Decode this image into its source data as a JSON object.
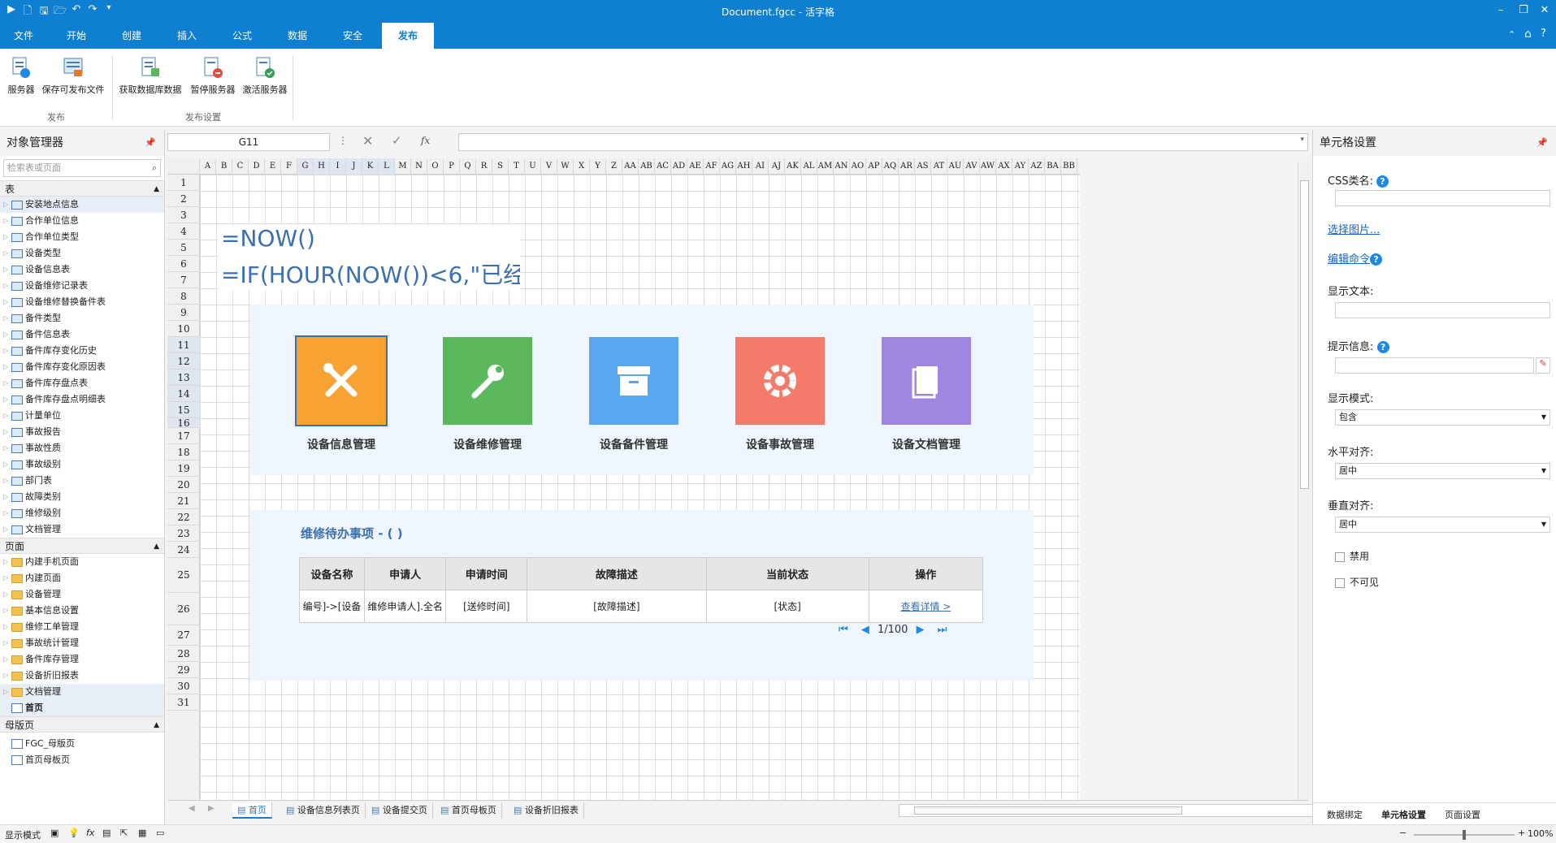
{
  "window": {
    "title": "Document.fgcc - 活字格"
  },
  "menu": {
    "tabs": [
      "文件",
      "开始",
      "创建",
      "插入",
      "公式",
      "数据",
      "安全",
      "发布"
    ],
    "active": "发布"
  },
  "ribbon": {
    "buttons": [
      "服务器",
      "保存可发布文件",
      "获取数据库数据",
      "暂停服务器",
      "激活服务器"
    ],
    "groups": [
      "发布",
      "发布设置"
    ]
  },
  "left_panel": {
    "title": "对象管理器",
    "search_placeholder": "检索表或页面",
    "tables_header": "表",
    "tables": [
      "安装地点信息",
      "合作单位信息",
      "合作单位类型",
      "设备类型",
      "设备信息表",
      "设备维修记录表",
      "设备维修替换备件表",
      "备件类型",
      "备件信息表",
      "备件库存变化历史",
      "备件库存变化原因表",
      "备件库存盘点表",
      "备件库存盘点明细表",
      "计量单位",
      "事故报告",
      "事故性质",
      "事故级别",
      "部门表",
      "故障类别",
      "维修级别",
      "文档管理"
    ],
    "pages_header": "页面",
    "pages": [
      "内建手机页面",
      "内建页面",
      "设备管理",
      "基本信息设置",
      "维修工单管理",
      "事故统计管理",
      "备件库存管理",
      "设备折旧报表",
      "文档管理",
      "首页"
    ],
    "masters_header": "母版页",
    "masters": [
      "FGC_母版页",
      "首页母板页"
    ]
  },
  "formula_bar": {
    "cell": "G11"
  },
  "grid": {
    "columns": [
      "A",
      "B",
      "C",
      "D",
      "E",
      "F",
      "G",
      "H",
      "I",
      "J",
      "K",
      "L",
      "M",
      "N",
      "O",
      "P",
      "Q",
      "R",
      "S",
      "T",
      "U",
      "V",
      "W",
      "X",
      "Y",
      "Z",
      "AA",
      "AB",
      "AC",
      "AD",
      "AE",
      "AF",
      "AG",
      "AH",
      "AI",
      "AJ",
      "AK",
      "AL",
      "AM",
      "AN",
      "AO",
      "AP",
      "AQ",
      "AR",
      "AS",
      "AT",
      "AU",
      "AV",
      "AW",
      "AX",
      "AY",
      "AZ",
      "BA",
      "BB"
    ],
    "rows": [
      "1",
      "2",
      "3",
      "4",
      "5",
      "6",
      "7",
      "8",
      "9",
      "10",
      "11",
      "12",
      "13",
      "14",
      "15",
      "16",
      "17",
      "18",
      "19",
      "20",
      "21",
      "22",
      "23",
      "24",
      "25",
      "26",
      "27",
      "28",
      "29",
      "30",
      "31"
    ],
    "formula1": "=NOW()",
    "formula2": "=IF(HOUR(NOW())<6,\"已经"
  },
  "tiles": [
    {
      "label": "设备信息管理",
      "color": "#f7a233",
      "icon": "tools-icon"
    },
    {
      "label": "设备维修管理",
      "color": "#5cb85c",
      "icon": "wrench-icon"
    },
    {
      "label": "设备备件管理",
      "color": "#5aa6f0",
      "icon": "archive-icon"
    },
    {
      "label": "设备事故管理",
      "color": "#f47a6a",
      "icon": "gear-icon"
    },
    {
      "label": "设备文档管理",
      "color": "#9f86e0",
      "icon": "document-icon"
    }
  ],
  "todo": {
    "title": "维修待办事项 - (    )",
    "headers": [
      "设备名称",
      "申请人",
      "申请时间",
      "故障描述",
      "当前状态",
      "操作"
    ],
    "row": [
      "编号]->[设备",
      "维修申请人].全名",
      "[送修时间]",
      "[故障描述]",
      "[状态]",
      "查看详情 >"
    ],
    "pager": "1/100"
  },
  "sheet_tabs": [
    "首页",
    "设备信息列表页",
    "设备提交页",
    "首页母板页",
    "设备折旧报表"
  ],
  "right_panel": {
    "title": "单元格设置",
    "css_label": "CSS类名:",
    "select_image": "选择图片...",
    "edit_command": "编辑命令",
    "display_text": "显示文本:",
    "tooltip": "提示信息:",
    "display_mode": "显示模式:",
    "display_mode_value": "包含",
    "h_align": "水平对齐:",
    "h_align_value": "居中",
    "v_align": "垂直对齐:",
    "v_align_value": "居中",
    "disabled": "禁用",
    "invisible": "不可见",
    "bottom_tabs": [
      "数据绑定",
      "单元格设置",
      "页面设置"
    ]
  },
  "status": {
    "mode": "显示模式",
    "zoom": "100%"
  }
}
